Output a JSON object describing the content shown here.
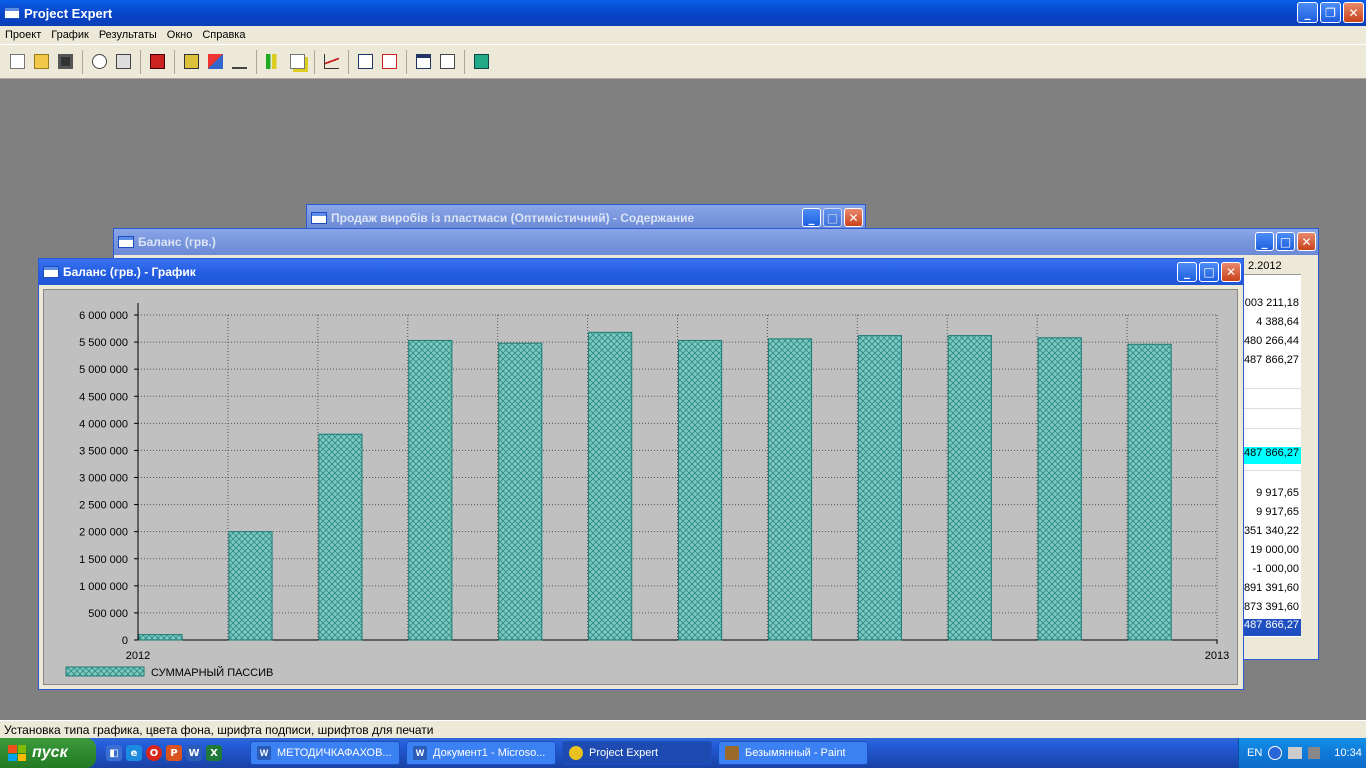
{
  "app": {
    "title": "Project Expert",
    "menu": [
      "Проект",
      "График",
      "Результаты",
      "Окно",
      "Справка"
    ],
    "status_text": "Установка типа графика, цвета фона, шрифта подписи, шрифтов для печати"
  },
  "windows": {
    "contents_title": "Продаж виробів із пластмаси (Оптимістичний) - Содержание",
    "balance_title": "Баланс (грв.)",
    "chart_title": "Баланс (грв.) - График"
  },
  "balance_table": {
    "header": "2.2012",
    "cells": [
      "003 211,18",
      "4 388,64",
      "480 266,44",
      "487 866,27",
      "487 866,27",
      "9 917,65",
      "9 917,65",
      "351 340,22",
      "19 000,00",
      "-1 000,00",
      "891 391,60",
      "873 391,60",
      "487 866,27"
    ]
  },
  "chart_data": {
    "type": "bar",
    "title": "",
    "xlabel": "",
    "ylabel": "",
    "x_start_label": "2012",
    "x_end_label": "2013",
    "ylim": [
      0,
      6000000
    ],
    "yticks": [
      "0",
      "500 000",
      "1 000 000",
      "1 500 000",
      "2 000 000",
      "2 500 000",
      "3 000 000",
      "3 500 000",
      "4 000 000",
      "4 500 000",
      "5 000 000",
      "5 500 000",
      "6 000 000"
    ],
    "series": [
      {
        "name": "СУММАРНЫЙ ПАССИВ",
        "values": [
          100000,
          2000000,
          3800000,
          5530000,
          5480000,
          5680000,
          5530000,
          5560000,
          5620000,
          5620000,
          5580000,
          5460000
        ]
      }
    ],
    "grid": true,
    "legend": "bottom-left",
    "bar_color": "#3aa8a0"
  },
  "taskbar": {
    "start_label": "пуск",
    "tasks": [
      "МЕТОДИЧКАФАХОВ...",
      "Документ1 - Microso...",
      "Project Expert",
      "Безымянный - Paint"
    ],
    "lang": "EN",
    "time": "10:34"
  }
}
